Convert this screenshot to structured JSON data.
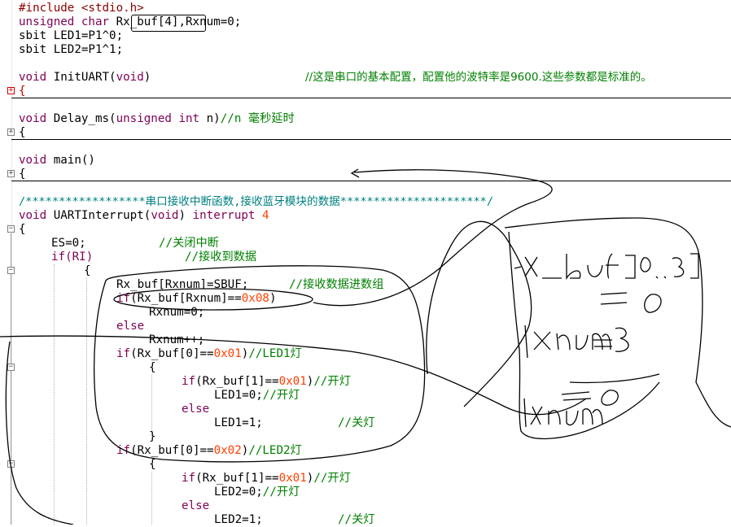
{
  "code": {
    "include": "#include <stdio.h>",
    "decl_kw": "unsigned char ",
    "decl_buf": "Rx_buf[4]",
    "decl_rest": ",Rxnum=0;",
    "sbit1": "sbit LED1=P1^0;",
    "sbit2": "sbit LED2=P1^1;",
    "init_kw": "void ",
    "init_name": "InitUART(",
    "init_param": "void",
    "init_close": ")",
    "init_comment": "//这是串口的基本配置，配置他的波特率是9600.这些参数都是标准的。",
    "brace_open": "{",
    "delay_kw": "void ",
    "delay_name": "Delay_ms(",
    "delay_param_kw": "unsigned int ",
    "delay_param": "n)",
    "delay_comment": "//n 毫秒延时",
    "main_kw": "void ",
    "main_name": "main()",
    "banner_comment": "/******************串口接收中断函数,接收蓝牙模块的数据**********************/",
    "isr_kw": "void ",
    "isr_name": "UARTInterrupt(",
    "isr_param": "void",
    "isr_close": ") ",
    "isr_interrupt": "interrupt ",
    "isr_num": "4",
    "es_line": "ES=0;",
    "es_comment": "//关闭中断",
    "if_ri": "if(RI)",
    "if_ri_comment": "//接收到数据",
    "inner_open": "{",
    "store_line": "Rx_buf[Rxnum]=SBUF;",
    "store_comment": "//接收数据进数组",
    "if_full_kw": "if",
    "if_full": "(Rx_buf[Rxnum]==",
    "if_full_num": "0x08",
    "if_full_close": ")",
    "reset_line": "Rxnum=0;",
    "else1": "else",
    "inc_line": "Rxnum++;",
    "if_led1_kw": "if",
    "if_led1": "(Rx_buf[0]==",
    "if_led1_num": "0x01",
    "if_led1_close": ")",
    "if_led1_comment": "//LED1灯",
    "if_on1_kw": "if",
    "if_on1": "(Rx_buf[1]==",
    "if_on1_num": "0x01",
    "if_on1_close": ")",
    "if_on1_comment": "//开灯",
    "led1_on": "LED1=0;",
    "led1_on_comment": "//开灯",
    "else2": "else",
    "led1_off": "LED1=1;",
    "led1_off_comment": "//关灯",
    "close_brace": "}",
    "if_led2_kw": "if",
    "if_led2": "(Rx_buf[0]==",
    "if_led2_num": "0x02",
    "if_led2_close": ")",
    "if_led2_comment": "//LED2灯",
    "if_on2_kw": "if",
    "if_on2": "(Rx_buf[1]==",
    "if_on2_num": "0x01",
    "if_on2_close": ")",
    "if_on2_comment": "//开灯",
    "led2_on": "LED2=0;",
    "led2_on_comment": "//开灯",
    "else3": "else",
    "led2_off": "LED2=1;",
    "led2_off_comment": "//关灯"
  },
  "fold_markers": {
    "plus": "+",
    "minus": "−"
  },
  "handwriting": {
    "note_buf": "x_buf[0..3]",
    "note_eq0": "= 0",
    "note_rxnum3": "rxnum=3",
    "note_rxnum0": "rxnum=0"
  }
}
